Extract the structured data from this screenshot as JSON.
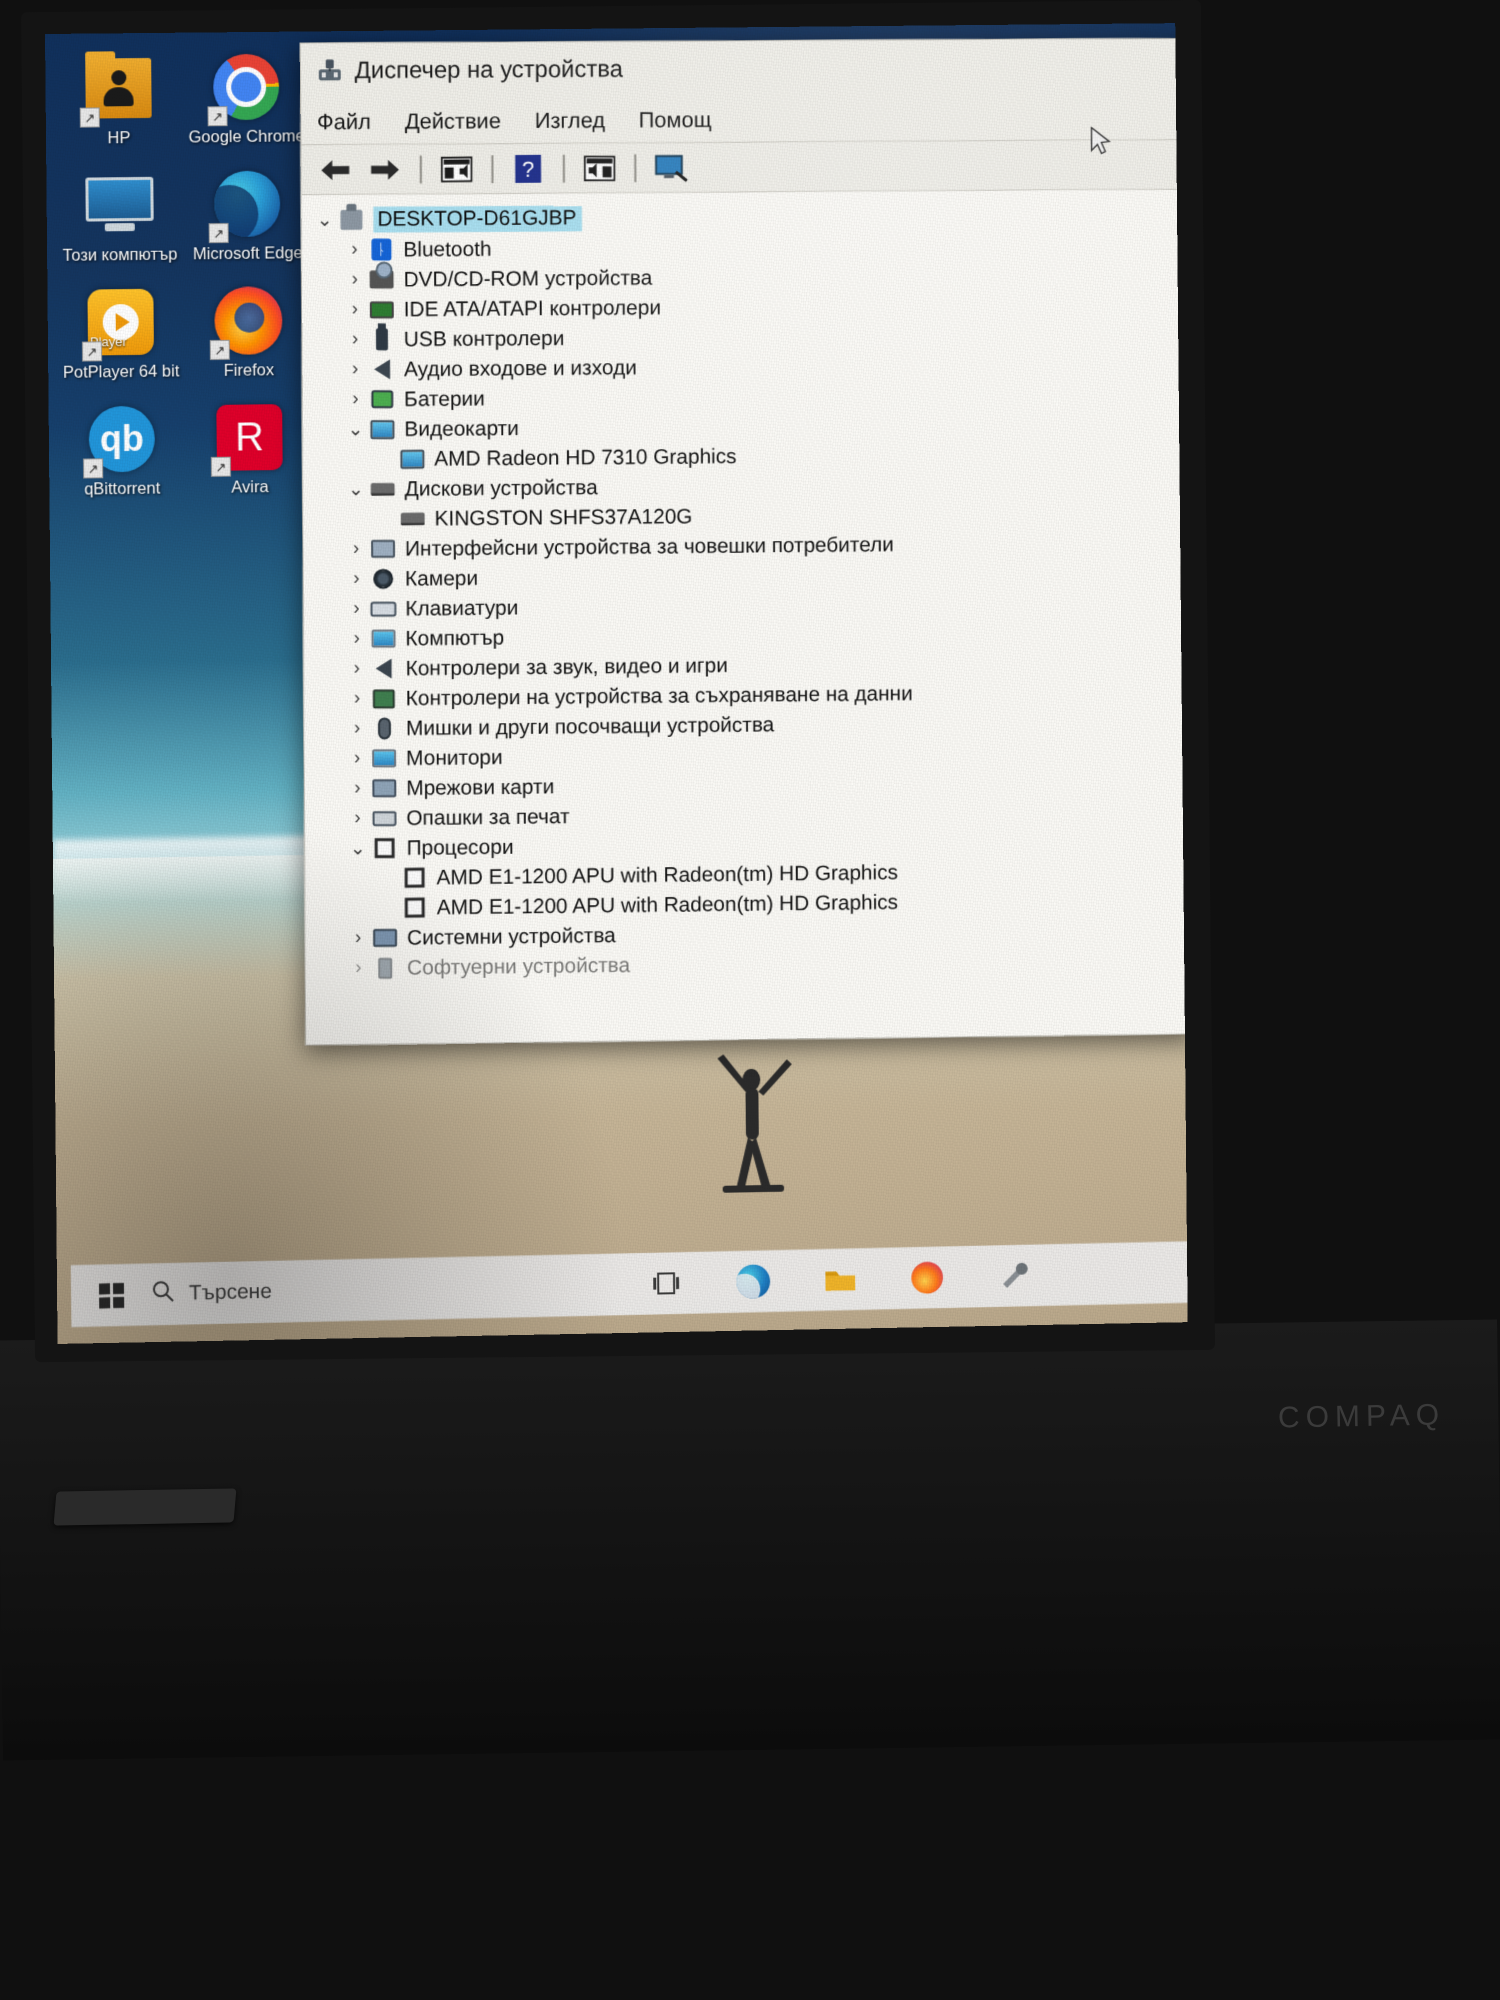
{
  "window": {
    "title": "Диспечер на устройства",
    "title_icon": "device-manager-icon",
    "menu": [
      "Файл",
      "Действие",
      "Изглед",
      "Помощ"
    ],
    "toolbar": [
      {
        "name": "back-button",
        "glyph": "back-arrow-icon"
      },
      {
        "name": "forward-button",
        "glyph": "forward-arrow-icon"
      },
      {
        "name": "properties-button",
        "glyph": "properties-icon"
      },
      {
        "name": "help-button",
        "glyph": "help-question-icon"
      },
      {
        "name": "show-hidden-button",
        "glyph": "details-pane-icon"
      },
      {
        "name": "scan-hardware-button",
        "glyph": "scan-monitor-icon"
      }
    ]
  },
  "tree": {
    "root": {
      "label": "DESKTOP-D61GJBP",
      "icon": "computer-icon",
      "expanded": true,
      "selected": true
    },
    "nodes": [
      {
        "label": "Bluetooth",
        "icon": "bluetooth-icon",
        "level": 1,
        "expanded": false
      },
      {
        "label": "DVD/CD-ROM устройства",
        "icon": "dvd-drive-icon",
        "level": 1,
        "expanded": false
      },
      {
        "label": "IDE ATA/ATAPI контролери",
        "icon": "ide-controller-icon",
        "level": 1,
        "expanded": false
      },
      {
        "label": "USB контролери",
        "icon": "usb-icon",
        "level": 1,
        "expanded": false
      },
      {
        "label": "Аудио входове и изходи",
        "icon": "speaker-icon",
        "level": 1,
        "expanded": false
      },
      {
        "label": "Батерии",
        "icon": "battery-icon",
        "level": 1,
        "expanded": false
      },
      {
        "label": "Видеокарти",
        "icon": "display-adapter-icon",
        "level": 1,
        "expanded": true
      },
      {
        "label": "AMD Radeon HD 7310 Graphics",
        "icon": "display-adapter-icon",
        "level": 2,
        "expanded": null
      },
      {
        "label": "Дискови устройства",
        "icon": "disk-drive-icon",
        "level": 1,
        "expanded": true
      },
      {
        "label": "KINGSTON SHFS37A120G",
        "icon": "disk-drive-icon",
        "level": 2,
        "expanded": null
      },
      {
        "label": "Интерфейсни устройства за човешки потребители",
        "icon": "hid-icon",
        "level": 1,
        "expanded": false
      },
      {
        "label": "Камери",
        "icon": "camera-icon",
        "level": 1,
        "expanded": false
      },
      {
        "label": "Клавиатури",
        "icon": "keyboard-icon",
        "level": 1,
        "expanded": false
      },
      {
        "label": "Компютър",
        "icon": "monitor-icon",
        "level": 1,
        "expanded": false
      },
      {
        "label": "Контролери за звук, видео и игри",
        "icon": "speaker-icon",
        "level": 1,
        "expanded": false
      },
      {
        "label": "Контролери на устройства за съхраняване на данни",
        "icon": "storage-controller-icon",
        "level": 1,
        "expanded": false
      },
      {
        "label": "Мишки и други посочващи устройства",
        "icon": "mouse-icon",
        "level": 1,
        "expanded": false
      },
      {
        "label": "Монитори",
        "icon": "monitor-icon",
        "level": 1,
        "expanded": false
      },
      {
        "label": "Мрежови карти",
        "icon": "network-adapter-icon",
        "level": 1,
        "expanded": false
      },
      {
        "label": "Опашки за печат",
        "icon": "printer-icon",
        "level": 1,
        "expanded": false
      },
      {
        "label": "Процесори",
        "icon": "cpu-icon",
        "level": 1,
        "expanded": true
      },
      {
        "label": "AMD E1-1200 APU with Radeon(tm) HD Graphics",
        "icon": "cpu-icon",
        "level": 2,
        "expanded": null
      },
      {
        "label": "AMD E1-1200 APU with Radeon(tm) HD Graphics",
        "icon": "cpu-icon",
        "level": 2,
        "expanded": null
      },
      {
        "label": "Системни устройства",
        "icon": "system-device-icon",
        "level": 1,
        "expanded": false
      },
      {
        "label": "Софтуерни устройства",
        "icon": "software-device-icon",
        "level": 1,
        "expanded": false
      }
    ]
  },
  "desktop": {
    "icons": [
      {
        "label": "HP",
        "icon": "hp-folder-icon",
        "shortcut": true
      },
      {
        "label": "Google Chrome",
        "icon": "chrome-icon",
        "shortcut": true
      },
      {
        "label": "Този компютър",
        "icon": "this-pc-icon",
        "shortcut": false
      },
      {
        "label": "Microsoft Edge",
        "icon": "edge-icon",
        "shortcut": true
      },
      {
        "label": "PotPlayer 64 bit",
        "icon": "potplayer-icon",
        "shortcut": true
      },
      {
        "label": "Firefox",
        "icon": "firefox-icon",
        "shortcut": true
      },
      {
        "label": "qBittorrent",
        "icon": "qbittorrent-icon",
        "shortcut": true
      },
      {
        "label": "Avira",
        "icon": "avira-icon",
        "shortcut": true
      }
    ]
  },
  "taskbar": {
    "start_icon": "windows-start-icon",
    "search_icon": "search-icon",
    "search_placeholder": "Търсене",
    "pinned": [
      {
        "name": "task-view-icon"
      },
      {
        "name": "edge-taskbar-icon"
      },
      {
        "name": "explorer-taskbar-icon"
      },
      {
        "name": "firefox-taskbar-icon"
      },
      {
        "name": "utility-taskbar-icon"
      }
    ]
  },
  "laptop": {
    "brand": "COMPAQ"
  },
  "colors": {
    "selection": "#a8dff0",
    "window_bg": "#f0efe9",
    "tree_bg": "#fbfaf6",
    "text": "#101010"
  }
}
